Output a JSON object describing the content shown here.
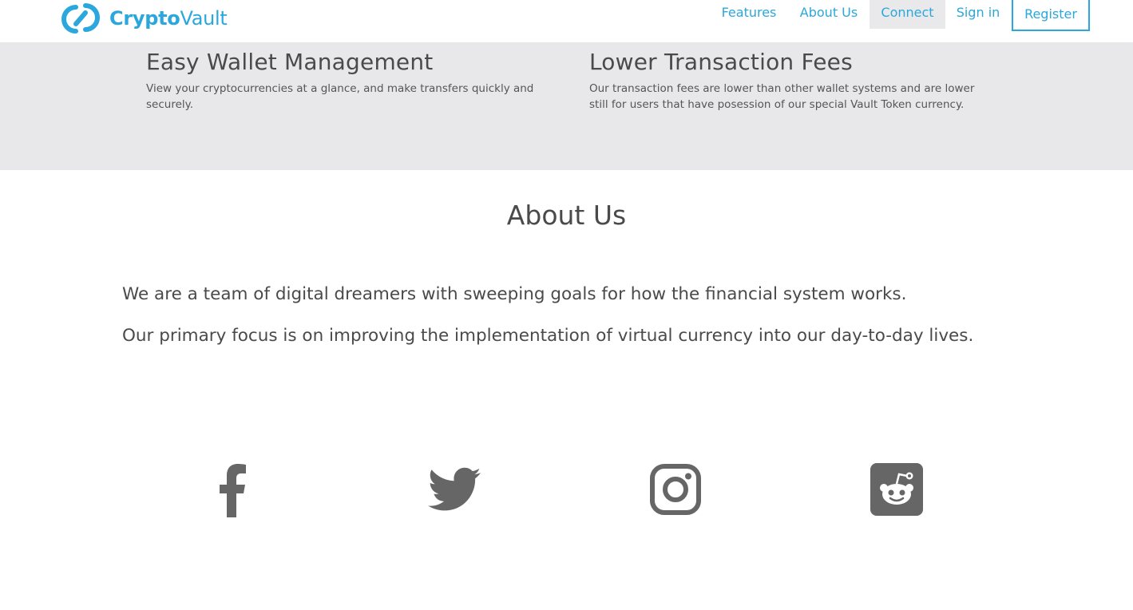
{
  "brand": {
    "name_bold": "Crypto",
    "name_light": "Vault",
    "accent_color": "#2aa7dc"
  },
  "nav": {
    "items": [
      "Features",
      "About Us",
      "Connect",
      "Sign in"
    ],
    "active": "Connect",
    "register": "Register"
  },
  "features": [
    {
      "title": "Easy Wallet Management",
      "text": "View your cryptocurrencies at a glance, and make transfers quickly and securely."
    },
    {
      "title": "Lower Transaction Fees",
      "text": "Our transaction fees are lower than other wallet systems and are lower still for users that have posession of our special Vault Token currency."
    }
  ],
  "about": {
    "title": "About Us",
    "paragraphs": [
      "We are a team of digital dreamers with sweeping goals for how the financial system works.",
      "Our primary focus is on improving the implementation of virtual currency into our day-to-day lives."
    ]
  },
  "social": {
    "icons": [
      "facebook-icon",
      "twitter-icon",
      "instagram-icon",
      "reddit-icon"
    ],
    "icon_color": "#666666"
  }
}
